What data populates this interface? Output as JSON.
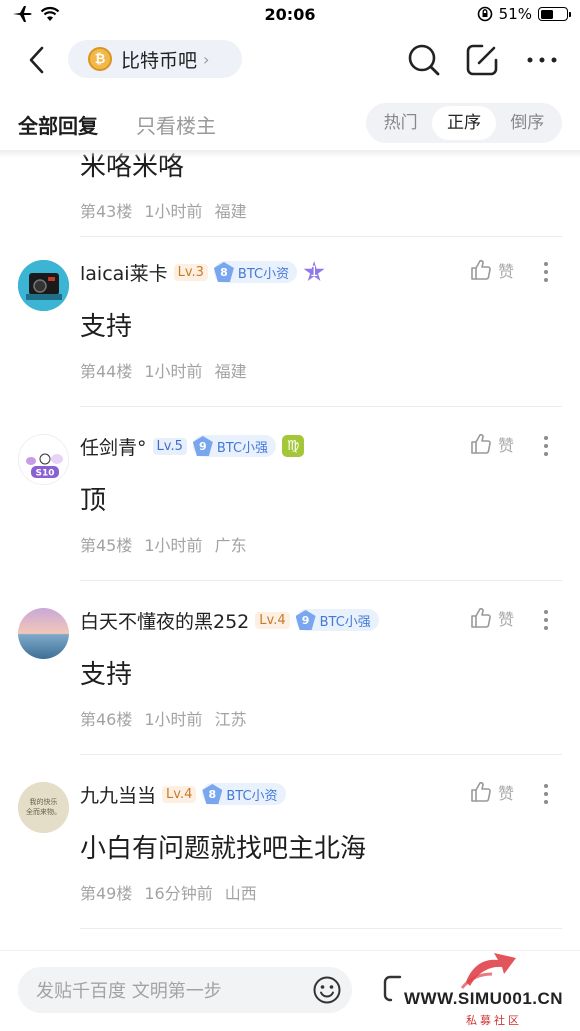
{
  "status_bar": {
    "time": "20:06",
    "battery": "51%",
    "battery_level": 0.51
  },
  "nav": {
    "forum_name": "比特币吧",
    "forum_icon": "bitcoin-coin-icon",
    "coin_symbol": "₿",
    "chevron": "›"
  },
  "tabs": {
    "all_replies": "全部回复",
    "owner_only": "只看楼主"
  },
  "sort": {
    "options": [
      "热门",
      "正序",
      "倒序"
    ],
    "selected": "正序"
  },
  "partial_post": {
    "content": "米咯米咯",
    "floor": "第43楼",
    "time": "1小时前",
    "location": "福建"
  },
  "posts": [
    {
      "username": "laicai莱卡",
      "level": "Lv.3",
      "badge_num": "8",
      "badge_text": "BTC小资",
      "extra_badge": "1",
      "content": "支持",
      "floor": "第44楼",
      "time": "1小时前",
      "location": "福建",
      "like": "赞"
    },
    {
      "username": "任剑青°",
      "level": "Lv.5",
      "badge_num": "9",
      "badge_text": "BTC小强",
      "extra_badge": "♍",
      "content": "顶",
      "floor": "第45楼",
      "time": "1小时前",
      "location": "广东",
      "like": "赞"
    },
    {
      "username": "白天不懂夜的黑252",
      "level": "Lv.4",
      "badge_num": "9",
      "badge_text": "BTC小强",
      "content": "支持",
      "floor": "第46楼",
      "time": "1小时前",
      "location": "江苏",
      "like": "赞"
    },
    {
      "username": "九九当当",
      "level": "Lv.4",
      "badge_num": "8",
      "badge_text": "BTC小资",
      "content": "小白有问题就找吧主北海",
      "floor": "第49楼",
      "time": "16分钟前",
      "location": "山西",
      "like": "赞"
    }
  ],
  "avatar_texts": {
    "post2": "S10",
    "post4": "我的快乐\n全而来物。"
  },
  "bottom": {
    "placeholder": "发贴千百度 文明第一步"
  },
  "watermark": {
    "text": "WWW.SIMU001.CN",
    "sub": "私募社区"
  },
  "colors": {
    "accent_blue": "#4479d6",
    "level_orange": "#c97a29",
    "coin_gold": "#f3b84a",
    "watermark_red": "#e0424a"
  }
}
